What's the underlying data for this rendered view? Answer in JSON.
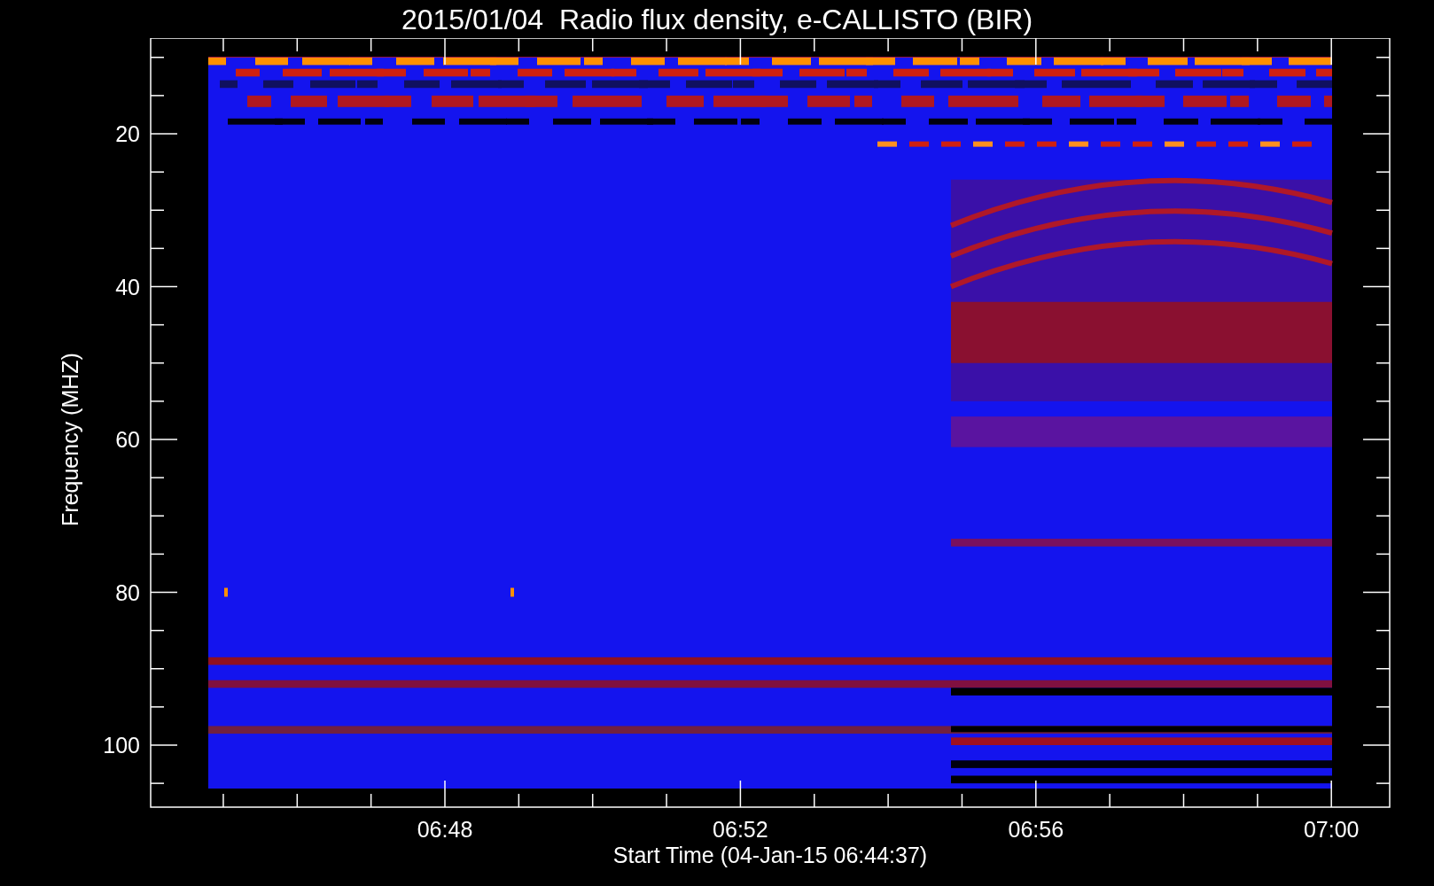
{
  "title": "2015/01/04  Radio flux density, e-CALLISTO (BIR)",
  "y_axis": {
    "label": "Frequency (MHZ)",
    "ticks": [
      "20",
      "40",
      "60",
      "80",
      "100"
    ]
  },
  "x_axis": {
    "label": "Start Time (04-Jan-15 06:44:37)",
    "ticks": [
      "06:48",
      "06:52",
      "06:56",
      "07:00"
    ]
  }
}
